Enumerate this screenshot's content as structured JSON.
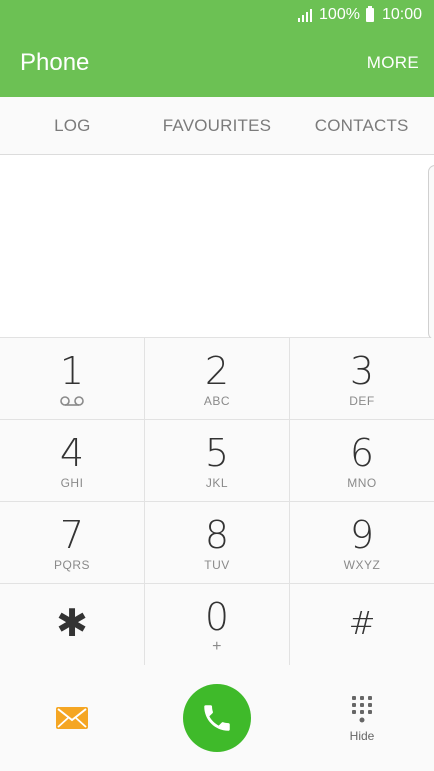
{
  "status_bar": {
    "battery": "100%",
    "time": "10:00"
  },
  "header": {
    "title": "Phone",
    "more_label": "MORE"
  },
  "tabs": [
    {
      "label": "LOG"
    },
    {
      "label": "FAVOURITES"
    },
    {
      "label": "CONTACTS"
    }
  ],
  "keypad": [
    {
      "digit": "1",
      "letters": "",
      "icon": "voicemail-icon"
    },
    {
      "digit": "2",
      "letters": "ABC"
    },
    {
      "digit": "3",
      "letters": "DEF"
    },
    {
      "digit": "4",
      "letters": "GHI"
    },
    {
      "digit": "5",
      "letters": "JKL"
    },
    {
      "digit": "6",
      "letters": "MNO"
    },
    {
      "digit": "7",
      "letters": "PQRS"
    },
    {
      "digit": "8",
      "letters": "TUV"
    },
    {
      "digit": "9",
      "letters": "WXYZ"
    },
    {
      "digit": "✱",
      "letters": ""
    },
    {
      "digit": "0",
      "letters": "+"
    },
    {
      "digit": "#",
      "letters": ""
    }
  ],
  "bottom_bar": {
    "hide_label": "Hide",
    "message_icon": "envelope-icon",
    "call_icon": "phone-handset-icon",
    "hide_icon": "dialpad-icon"
  },
  "colors": {
    "header": "#6cc154",
    "call_button": "#3fba2a",
    "message_icon": "#f5a623"
  }
}
